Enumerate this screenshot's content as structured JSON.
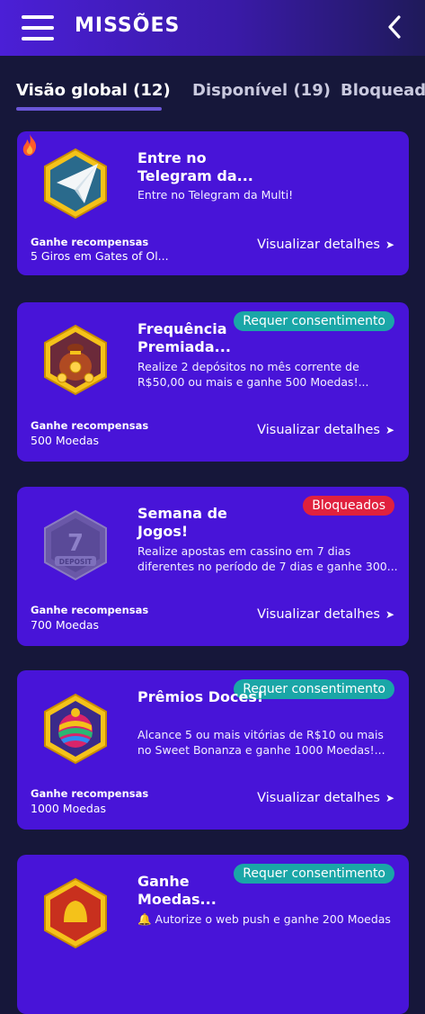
{
  "header": {
    "title": "MISSÕES"
  },
  "tabs": [
    {
      "label": "Visão global (12)"
    },
    {
      "label": "Disponível (19)"
    },
    {
      "label": "Bloqueados"
    }
  ],
  "missions": [
    {
      "title": "Entre no Telegram da...",
      "description": "Entre no Telegram da Multi!",
      "reward_label": "Ganhe recompensas",
      "reward_value": "5 Giros em Gates of Ol...",
      "details_label": "Visualizar detalhes",
      "badge": "",
      "icon": "telegram-icon"
    },
    {
      "title": "Frequência Premiada...",
      "description": "Realize 2 depósitos no mês corrente de R$50,00 ou mais e ganhe 500 Moedas!...",
      "reward_label": "Ganhe recompensas",
      "reward_value": "500 Moedas",
      "details_label": "Visualizar detalhes",
      "badge": "Requer consentimento",
      "icon": "coin-bag-icon"
    },
    {
      "title": "Semana de Jogos!",
      "description": "Realize apostas em cassino em 7 dias diferentes no período de 7 dias e ganhe 300...",
      "reward_label": "Ganhe recompensas",
      "reward_value": "700 Moedas",
      "details_label": "Visualizar detalhes",
      "badge": "Bloqueados",
      "icon": "deposit-badge-icon",
      "icon_text": "DEPOSIT"
    },
    {
      "title": "Prêmios Doces!",
      "description": "Alcance 5 ou mais vitórias de R$10 ou mais no Sweet Bonanza e ganhe 1000 Moedas!...",
      "reward_label": "Ganhe recompensas",
      "reward_value": "1000 Moedas",
      "details_label": "Visualizar detalhes",
      "badge": "Requer consentimento",
      "icon": "candy-icon"
    },
    {
      "title": "Ganhe Moedas...",
      "description": "🔔 Autorize o web push e ganhe 200 Moedas",
      "badge": "Requer consentimento",
      "icon": "bell-icon"
    }
  ],
  "colors": {
    "card": "#4814d8",
    "background": "#16173a",
    "badge_consent": "#1aa6a7",
    "badge_locked": "#e0213e"
  }
}
